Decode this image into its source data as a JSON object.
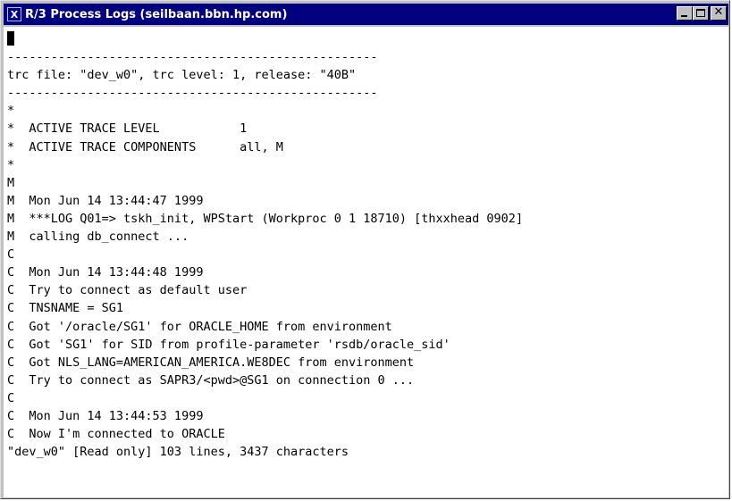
{
  "window": {
    "title": "R/3 Process Logs (seilbaan.bbn.hp.com)",
    "icon": "x-terminal-icon",
    "icon_glyph": "X",
    "controls": {
      "minimize": "minimize-icon",
      "maximize": "maximize-icon",
      "close": "close-icon",
      "close_glyph": "✕"
    }
  },
  "terminal": {
    "lines": [
      "",
      "---------------------------------------------------",
      "trc file: \"dev_w0\", trc level: 1, release: \"40B\"",
      "---------------------------------------------------",
      "*",
      "*  ACTIVE TRACE LEVEL           1",
      "*  ACTIVE TRACE COMPONENTS      all, M",
      "*",
      "M",
      "M  Mon Jun 14 13:44:47 1999",
      "M  ***LOG Q01=> tskh_init, WPStart (Workproc 0 1 18710) [thxxhead 0902]",
      "M  calling db_connect ...",
      "C",
      "C  Mon Jun 14 13:44:48 1999",
      "C  Try to connect as default user",
      "C  TNSNAME = SG1",
      "C  Got '/oracle/SG1' for ORACLE_HOME from environment",
      "C  Got 'SG1' for SID from profile-parameter 'rsdb/oracle_sid'",
      "C  Got NLS_LANG=AMERICAN_AMERICA.WE8DEC from environment",
      "C  Try to connect as SAPR3/<pwd>@SG1 on connection 0 ...",
      "C",
      "C  Mon Jun 14 13:44:53 1999",
      "C  Now I'm connected to ORACLE",
      "\"dev_w0\" [Read only] 103 lines, 3437 characters"
    ]
  },
  "colors": {
    "titlebar": "#000080",
    "terminal_bg": "#ffffff",
    "text": "#000000"
  }
}
